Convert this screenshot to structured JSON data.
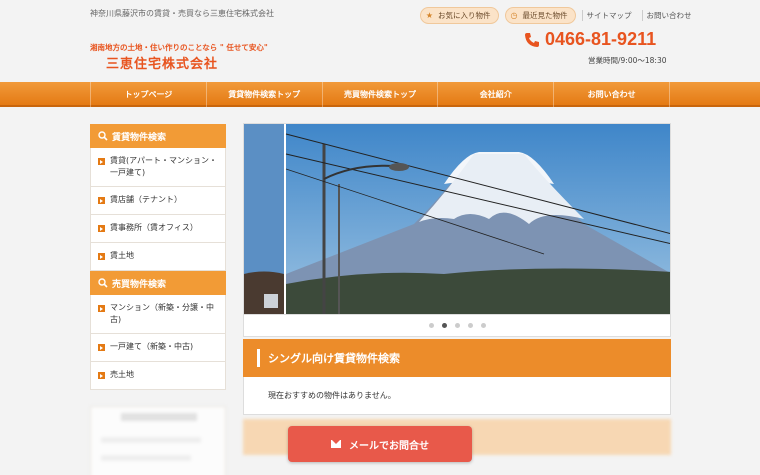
{
  "header": {
    "tagline": "神奈川県藤沢市の賃貸・売買なら三恵住宅株式会社",
    "logo_sub": "湘南地方の土地・住い作りのことなら \" 任せて安心\"",
    "logo_main": "三恵住宅株式会社",
    "favorites": "お気に入り物件",
    "recent": "最近見た物件",
    "sitemap": "サイトマップ",
    "contact": "お問い合わせ",
    "phone": "0466-81-9211",
    "hours": "営業時間/9:00～18:30"
  },
  "nav": {
    "items": [
      "トップページ",
      "賃貸物件検索トップ",
      "売買物件検索トップ",
      "会社紹介",
      "お問い合わせ"
    ]
  },
  "sidebar": {
    "rental_title": "賃貸物件検索",
    "rental_items": [
      "賃貸(アパート・マンション・一戸建て)",
      "賃店舗（テナント）",
      "賃事務所（賃オフィス）",
      "賃土地"
    ],
    "sale_title": "売買物件検索",
    "sale_items": [
      "マンション（新築・分譲・中古)",
      "一戸建て（新築・中古)",
      "売土地"
    ]
  },
  "main": {
    "section_title": "シングル向け賃貸物件検索",
    "empty_message": "現在おすすめの物件はありません。"
  },
  "mail_button": "メールでお問合せ",
  "colors": {
    "accent": "#e47a14",
    "brand": "#e8541f",
    "mail": "#e8594a"
  }
}
